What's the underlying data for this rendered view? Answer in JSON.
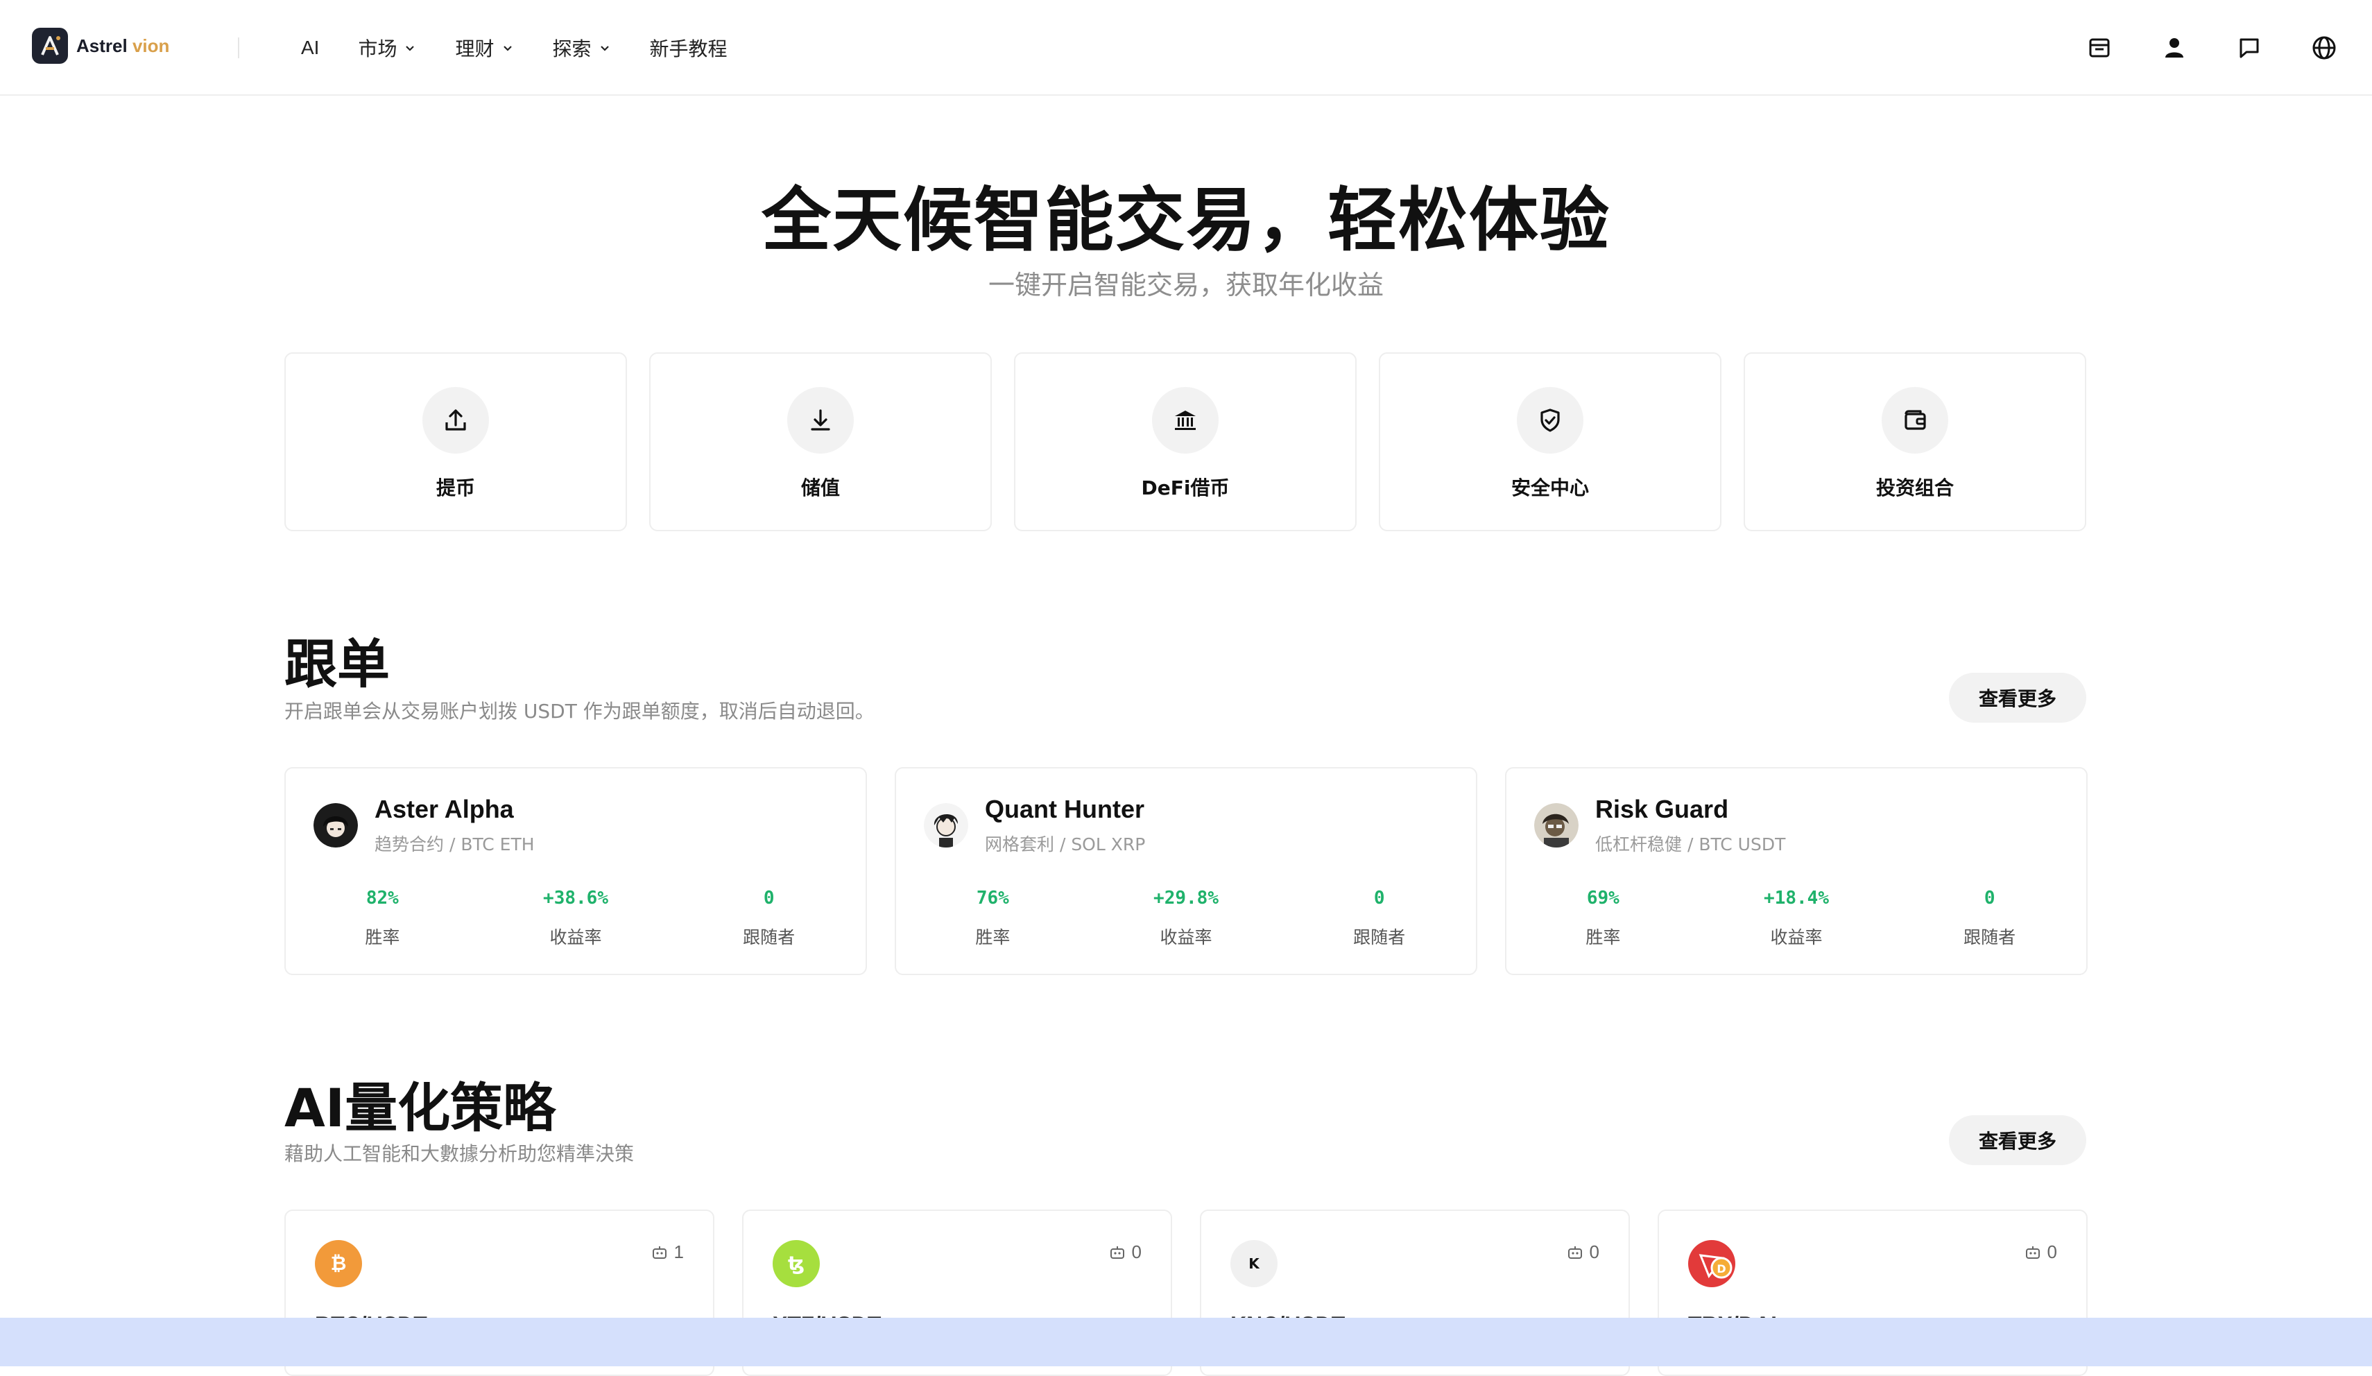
{
  "brand": {
    "name_a": "Astrel",
    "name_b": "vion"
  },
  "nav": [
    {
      "label": "AI",
      "dropdown": false
    },
    {
      "label": "市场",
      "dropdown": true
    },
    {
      "label": "理财",
      "dropdown": true
    },
    {
      "label": "探索",
      "dropdown": true
    },
    {
      "label": "新手教程",
      "dropdown": false
    }
  ],
  "header_icons": [
    "inbox-icon",
    "user-icon",
    "message-icon",
    "globe-icon"
  ],
  "hero": {
    "title": "全天候智能交易，轻松体验",
    "subtitle": "一键开启智能交易，获取年化收益"
  },
  "actions": [
    {
      "label": "提币",
      "icon": "upload-icon"
    },
    {
      "label": "储值",
      "icon": "download-icon"
    },
    {
      "label": "DeFi借币",
      "icon": "bank-icon"
    },
    {
      "label": "安全中心",
      "icon": "shield-check-icon"
    },
    {
      "label": "投资组合",
      "icon": "wallet-icon"
    }
  ],
  "copy_trading": {
    "title": "跟单",
    "description": "开启跟单会从交易账户划拨 USDT 作为跟单额度，取消后自动退回。",
    "more": "查看更多",
    "traders": [
      {
        "name": "Aster Alpha",
        "tag": "趋势合约 / BTC ETH",
        "win_rate": "82%",
        "return": "+38.6%",
        "followers": "0"
      },
      {
        "name": "Quant Hunter",
        "tag": "网格套利 / SOL XRP",
        "win_rate": "76%",
        "return": "+29.8%",
        "followers": "0"
      },
      {
        "name": "Risk Guard",
        "tag": "低杠杆稳健 / BTC USDT",
        "win_rate": "69%",
        "return": "+18.4%",
        "followers": "0"
      }
    ],
    "labels": {
      "win_rate": "胜率",
      "return": "收益率",
      "followers": "跟随者"
    }
  },
  "ai_strategy": {
    "title": "AI量化策略",
    "description": "藉助人工智能和大數據分析助您精準決策",
    "more": "查看更多",
    "cards": [
      {
        "pair": "BTC/USDT",
        "bots": "1",
        "coin_color": "#f29a3a"
      },
      {
        "pair": "XTZ/USDT",
        "bots": "0",
        "coin_color": "#a6df3e"
      },
      {
        "pair": "KNC/USDT",
        "bots": "0",
        "coin_color": "#f0f0f0"
      },
      {
        "pair": "TRX/DAI",
        "bots": "0",
        "coin_color": "#e23a3a"
      }
    ]
  },
  "colors": {
    "accent_green": "#1fb26b",
    "brand_gold": "#d9a04b",
    "brand_dark": "#1f2330"
  }
}
